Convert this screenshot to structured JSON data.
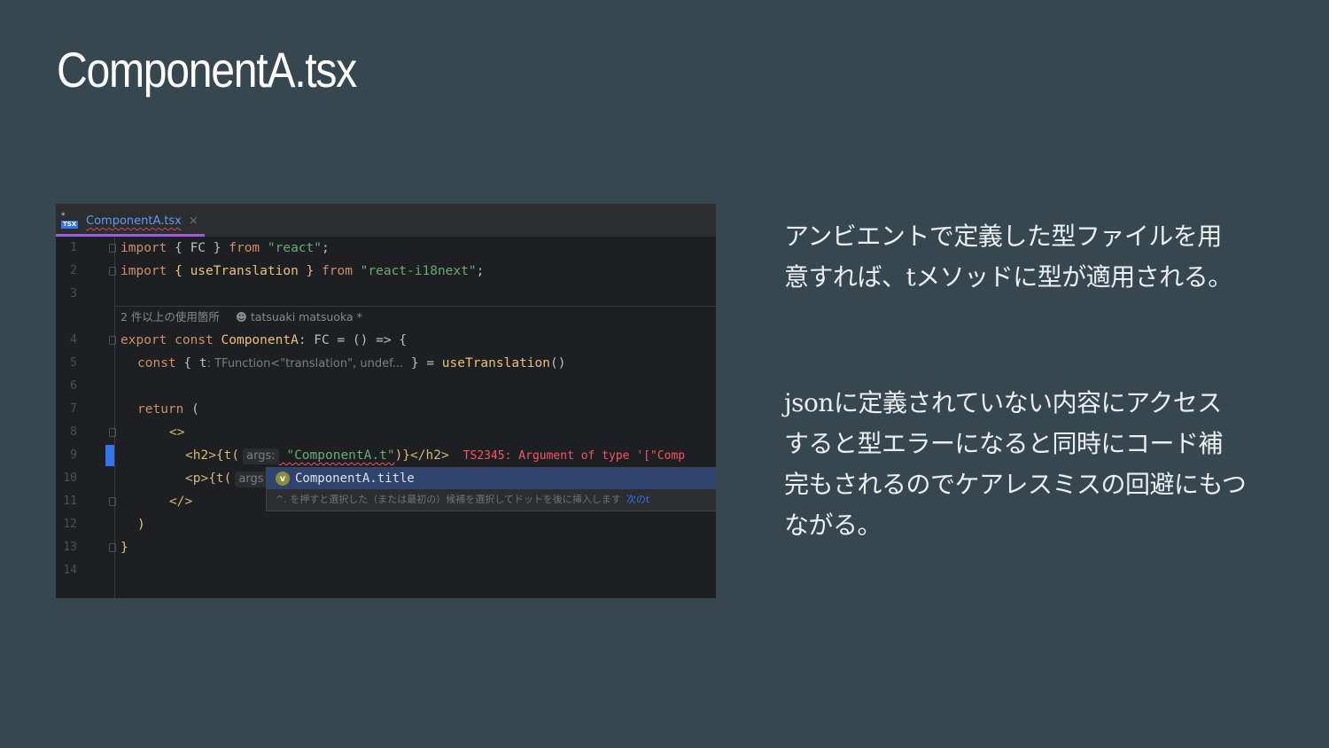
{
  "slide": {
    "title": "ComponentA.tsx",
    "paragraph1_lines": [
      "アンビエントで定義した型ファイルを用",
      "意すれば、tメソッドに型が適用される。"
    ],
    "paragraph2_lines": [
      "jsonに定義されていない内容にアクセス",
      "すると型エラーになると同時にコード補",
      "完もされるのでケアレスミスの回避にもつ",
      "ながる。"
    ]
  },
  "editor": {
    "tab": {
      "icon_top": "*",
      "icon_badge": "TSX",
      "label": "ComponentA.tsx",
      "close": "×"
    },
    "usage_hint": {
      "count": "2 件以上の使用箇所",
      "author_icon": "person-icon",
      "author": "tatsuaki matsuoka *"
    },
    "line_numbers": [
      "1",
      "2",
      "3",
      "4",
      "5",
      "6",
      "7",
      "8",
      "9",
      "10",
      "11",
      "12",
      "13",
      "14"
    ],
    "code": {
      "l1": {
        "kw1": "import",
        "mid": " { FC } ",
        "kw2": "from",
        "str": " \"react\"",
        "end": ";"
      },
      "l2": {
        "kw1": "import",
        "mid": " { useTranslation } ",
        "kw2": "from",
        "str": " \"react-i18next\"",
        "end": ";"
      },
      "l4": {
        "kw1": "export",
        "kw2": " const",
        "name": " ComponentA",
        "rest": ": FC = () => {"
      },
      "l5": {
        "kw": "const",
        "open": " { ",
        "var": "t",
        "hint": ": TFunction<\"translation\", undef...",
        "close": " } = ",
        "fn": "useTranslation",
        "end": "()"
      },
      "l7": {
        "kw": "return",
        "rest": " ("
      },
      "l8": {
        "tag": "<>"
      },
      "l9": {
        "open": "<h2>{t(",
        "hint": "args:",
        "str": " \"ComponentA.t\"",
        "close": ")}</h2>",
        "err": "TS2345: Argument of type '[\"Comp"
      },
      "l10": {
        "open": "<p>{t(",
        "hint": "args"
      },
      "l11": {
        "tag": "</>"
      },
      "l12": {
        "text": ")"
      },
      "l13": {
        "text": "}"
      }
    },
    "completion_popup": {
      "badge": "v",
      "item": "ComponentA.title",
      "footer": "^. を押すと選択した（または最初の）候補を選択してドットを後に挿入します",
      "footer_link": "次のt"
    }
  }
}
